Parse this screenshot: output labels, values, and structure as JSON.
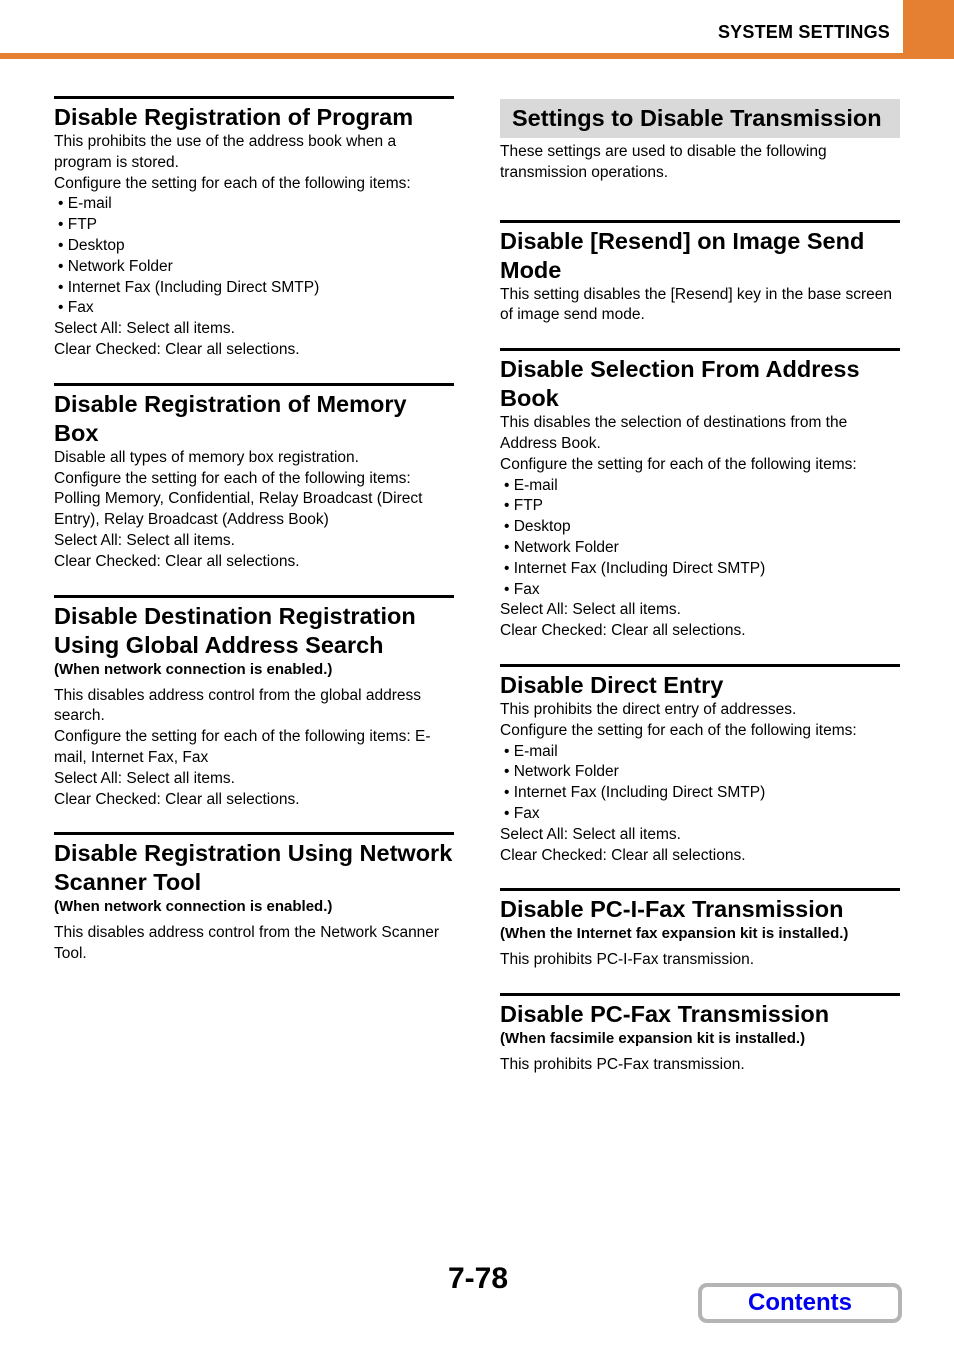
{
  "header": {
    "title": "SYSTEM SETTINGS",
    "accent_color": "#e58033"
  },
  "left_column": [
    {
      "title": "Disable Registration of Program",
      "lines": [
        "This prohibits the use of the address book when a program is stored.",
        "Configure the setting for each of the following items:"
      ],
      "bullets": [
        "E-mail",
        "FTP",
        "Desktop",
        "Network Folder",
        "Internet Fax (Including Direct SMTP)",
        "Fax"
      ],
      "footer": [
        "Select All: Select all items.",
        "Clear Checked: Clear all selections."
      ]
    },
    {
      "title": "Disable Registration of Memory Box",
      "lines": [
        "Disable all types of memory box registration.",
        "Configure the setting for each of the following items: Polling Memory, Confidential, Relay Broadcast (Direct Entry), Relay Broadcast (Address Book)",
        "Select All: Select all items.",
        "Clear Checked: Clear all selections."
      ]
    },
    {
      "title": "Disable Destination Registration Using Global Address Search",
      "condition": "(When network connection is enabled.)",
      "lines": [
        "This disables address control from the global address search.",
        "Configure the setting for each of the following items: E-mail, Internet Fax, Fax",
        "Select All: Select all items.",
        "Clear Checked: Clear all selections."
      ]
    },
    {
      "title": "Disable Registration Using Network Scanner Tool",
      "condition": "(When network connection is enabled.)",
      "lines": [
        "This disables address control from the Network Scanner Tool."
      ]
    }
  ],
  "right_column": {
    "band_title": "Settings to Disable Transmission",
    "intro": "These settings are used to disable the following transmission operations.",
    "sections": [
      {
        "title": "Disable [Resend] on Image Send Mode",
        "lines": [
          "This setting disables the [Resend] key in the base screen of image send mode."
        ]
      },
      {
        "title": "Disable Selection From Address Book",
        "lines": [
          "This disables the selection of destinations from the Address Book.",
          "Configure the setting for each of the following items:"
        ],
        "bullets": [
          "E-mail",
          "FTP",
          "Desktop",
          "Network Folder",
          "Internet Fax (Including Direct SMTP)",
          "Fax"
        ],
        "footer": [
          "Select All: Select all items.",
          "Clear Checked: Clear all selections."
        ]
      },
      {
        "title": "Disable Direct Entry",
        "lines": [
          "This prohibits the direct entry of addresses.",
          "Configure the setting for each of the following items:"
        ],
        "bullets": [
          "E-mail",
          "Network Folder",
          "Internet Fax (Including Direct SMTP)",
          "Fax"
        ],
        "footer": [
          "Select All: Select all items.",
          "Clear Checked: Clear all selections."
        ]
      },
      {
        "title": "Disable PC-I-Fax Transmission",
        "condition": "(When the Internet fax expansion kit is installed.)",
        "lines": [
          "This prohibits PC-I-Fax transmission."
        ]
      },
      {
        "title": "Disable PC-Fax Transmission",
        "condition": "(When facsimile expansion kit is installed.)",
        "lines": [
          "This prohibits PC-Fax transmission."
        ]
      }
    ]
  },
  "footer": {
    "page_number": "7-78",
    "contents_label": "Contents"
  }
}
